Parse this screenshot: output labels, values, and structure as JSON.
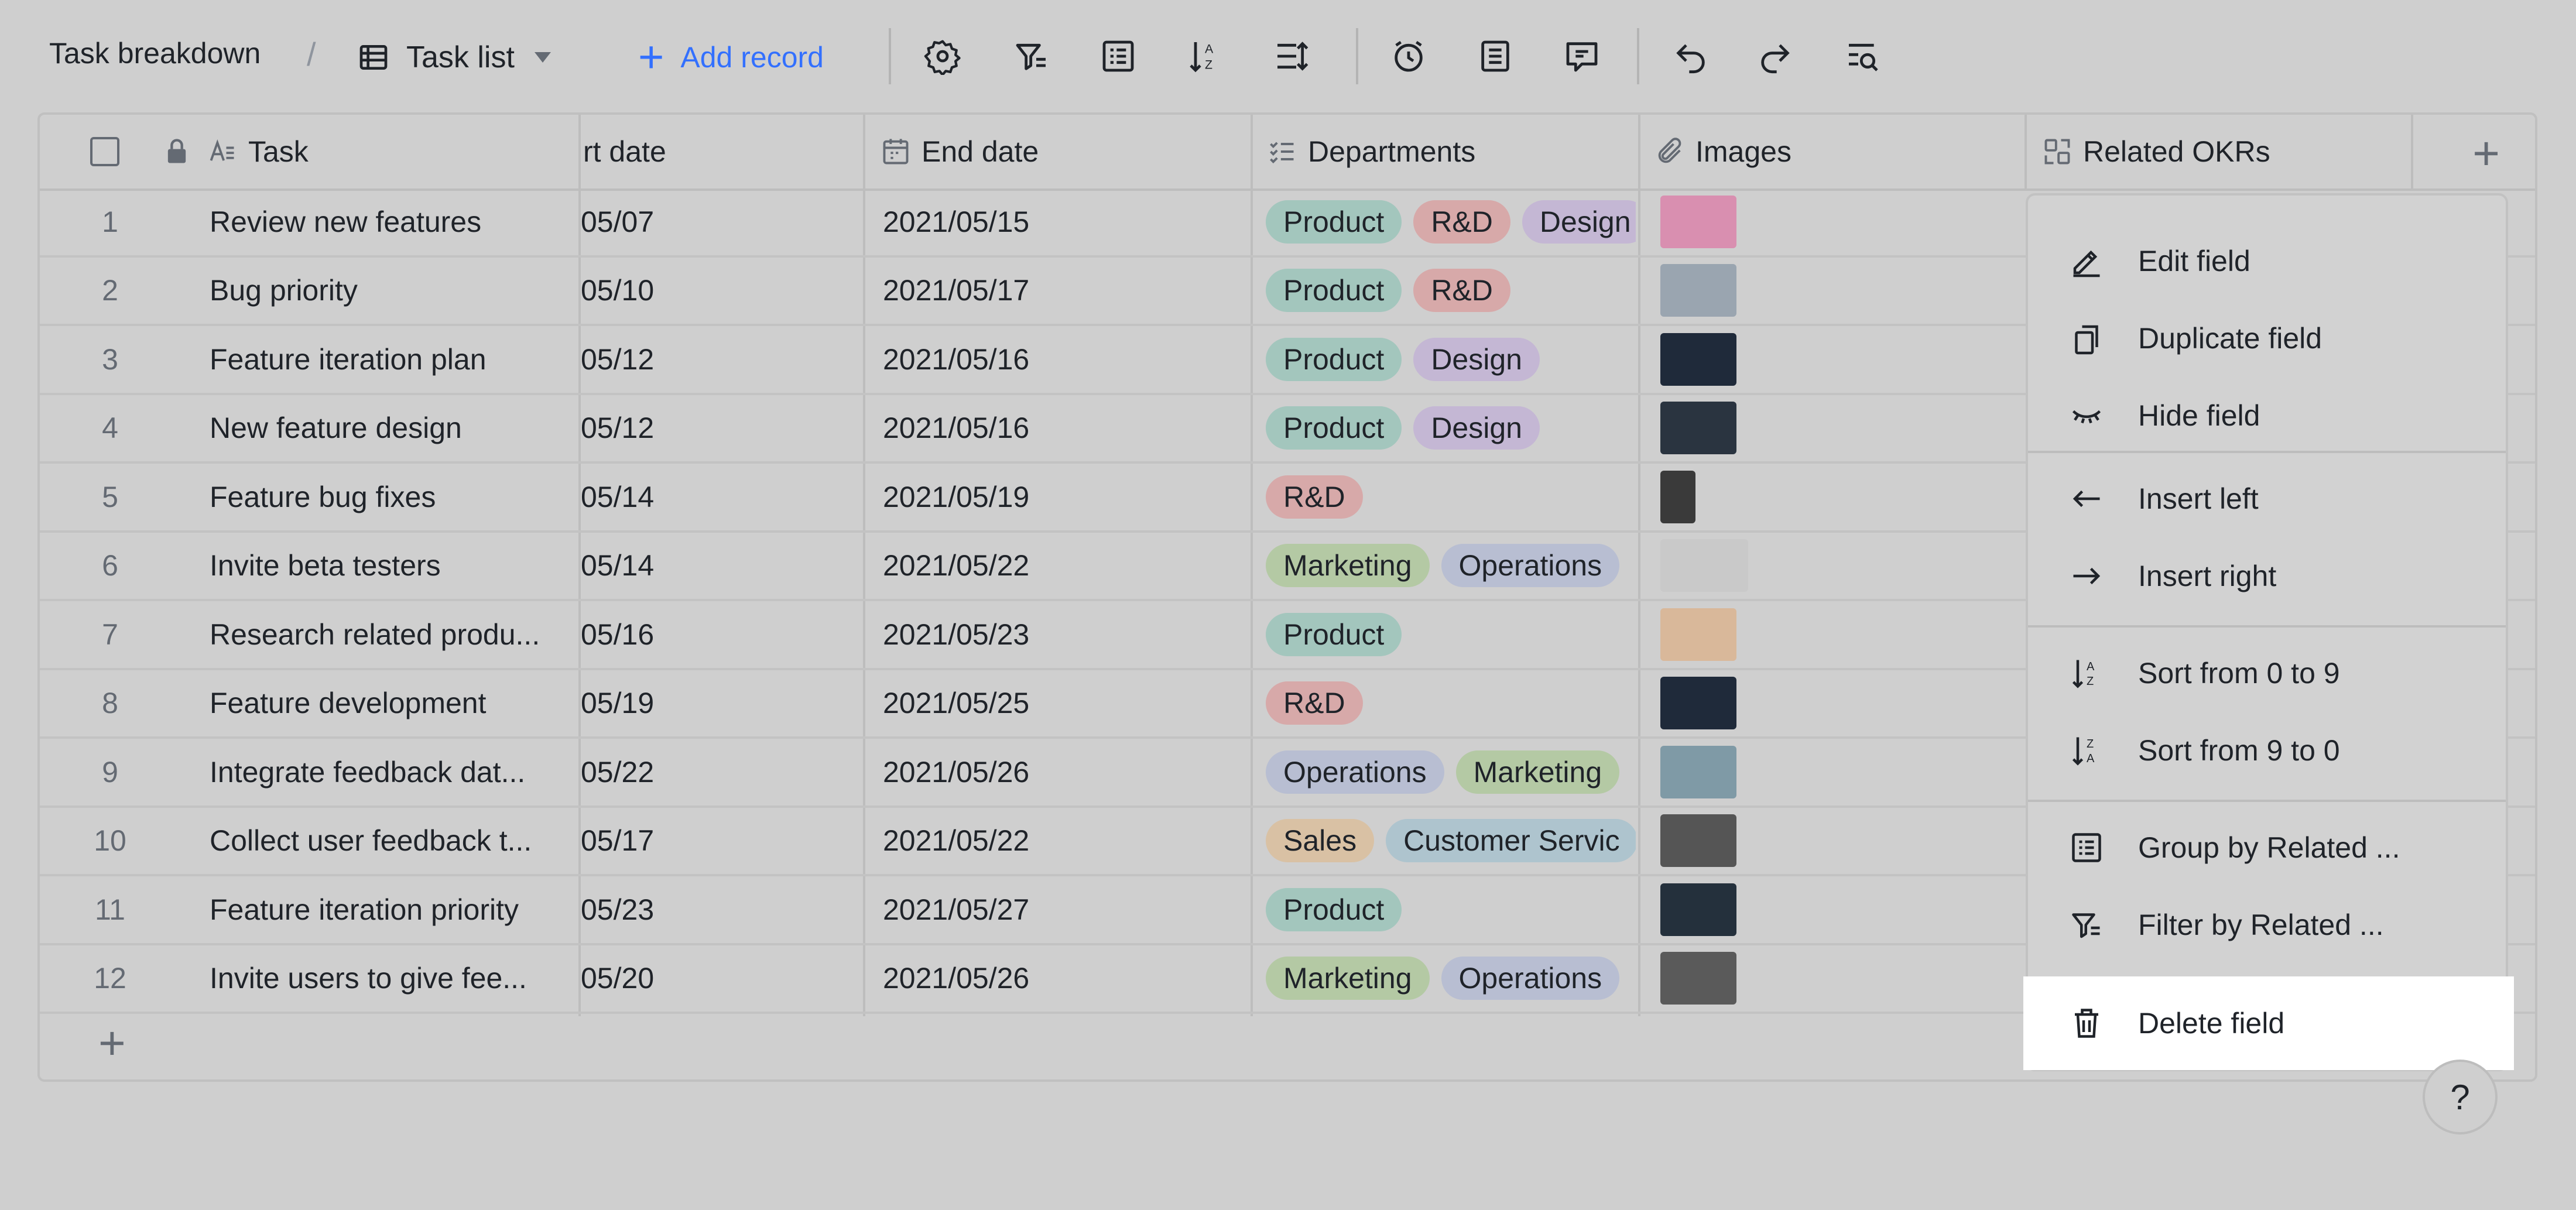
{
  "toolbar": {
    "title": "Task breakdown",
    "separator": "/",
    "view_name": "Task list",
    "add_record_label": "Add record",
    "icons": [
      "settings-icon",
      "filter-icon",
      "group-icon",
      "sort-icon",
      "row-height-icon",
      "reminder-icon",
      "form-icon",
      "comment-icon",
      "undo-icon",
      "redo-icon",
      "search-icon"
    ]
  },
  "table": {
    "headers": {
      "task": "Task",
      "start_date": "rt date",
      "end_date": "End date",
      "departments": "Departments",
      "images": "Images",
      "related_okrs": "Related OKRs"
    },
    "rows": [
      {
        "num": "1",
        "task": "Review new features",
        "start": "05/07",
        "end": "2021/05/15",
        "tags": [
          "Product",
          "R&D",
          "Design"
        ]
      },
      {
        "num": "2",
        "task": "Bug priority",
        "start": "05/10",
        "end": "2021/05/17",
        "tags": [
          "Product",
          "R&D"
        ]
      },
      {
        "num": "3",
        "task": "Feature iteration plan",
        "start": "05/12",
        "end": "2021/05/16",
        "tags": [
          "Product",
          "Design"
        ]
      },
      {
        "num": "4",
        "task": "New feature design",
        "start": "05/12",
        "end": "2021/05/16",
        "tags": [
          "Product",
          "Design"
        ]
      },
      {
        "num": "5",
        "task": "Feature bug fixes",
        "start": "05/14",
        "end": "2021/05/19",
        "tags": [
          "R&D"
        ]
      },
      {
        "num": "6",
        "task": "Invite beta testers",
        "start": "05/14",
        "end": "2021/05/22",
        "tags": [
          "Marketing",
          "Operations"
        ]
      },
      {
        "num": "7",
        "task": "Research related produ...",
        "start": "05/16",
        "end": "2021/05/23",
        "tags": [
          "Product"
        ]
      },
      {
        "num": "8",
        "task": "Feature development",
        "start": "05/19",
        "end": "2021/05/25",
        "tags": [
          "R&D"
        ]
      },
      {
        "num": "9",
        "task": "Integrate feedback dat...",
        "start": "05/22",
        "end": "2021/05/26",
        "tags": [
          "Operations",
          "Marketing"
        ]
      },
      {
        "num": "10",
        "task": "Collect user feedback t...",
        "start": "05/17",
        "end": "2021/05/22",
        "tags": [
          "Sales",
          "Customer Servic"
        ]
      },
      {
        "num": "11",
        "task": "Feature iteration priority",
        "start": "05/23",
        "end": "2021/05/27",
        "tags": [
          "Product"
        ]
      },
      {
        "num": "12",
        "task": "Invite users to give fee...",
        "start": "05/20",
        "end": "2021/05/26",
        "tags": [
          "Marketing",
          "Operations"
        ]
      }
    ]
  },
  "tag_colors": {
    "Product": "#a3c6bd",
    "R&D": "#d7a9a9",
    "Design": "#c4b7d4",
    "Marketing": "#b4c9a4",
    "Operations": "#b8bed2",
    "Sales": "#d9c1a4",
    "Customer Servic": "#aec4ce"
  },
  "menu": {
    "edit_field": "Edit field",
    "duplicate_field": "Duplicate field",
    "hide_field": "Hide field",
    "insert_left": "Insert left",
    "insert_right": "Insert right",
    "sort_asc": "Sort from 0 to 9",
    "sort_desc": "Sort from 9 to 0",
    "group_by": "Group by Related ...",
    "filter_by": "Filter by Related ...",
    "delete_field": "Delete field"
  },
  "help_label": "?"
}
